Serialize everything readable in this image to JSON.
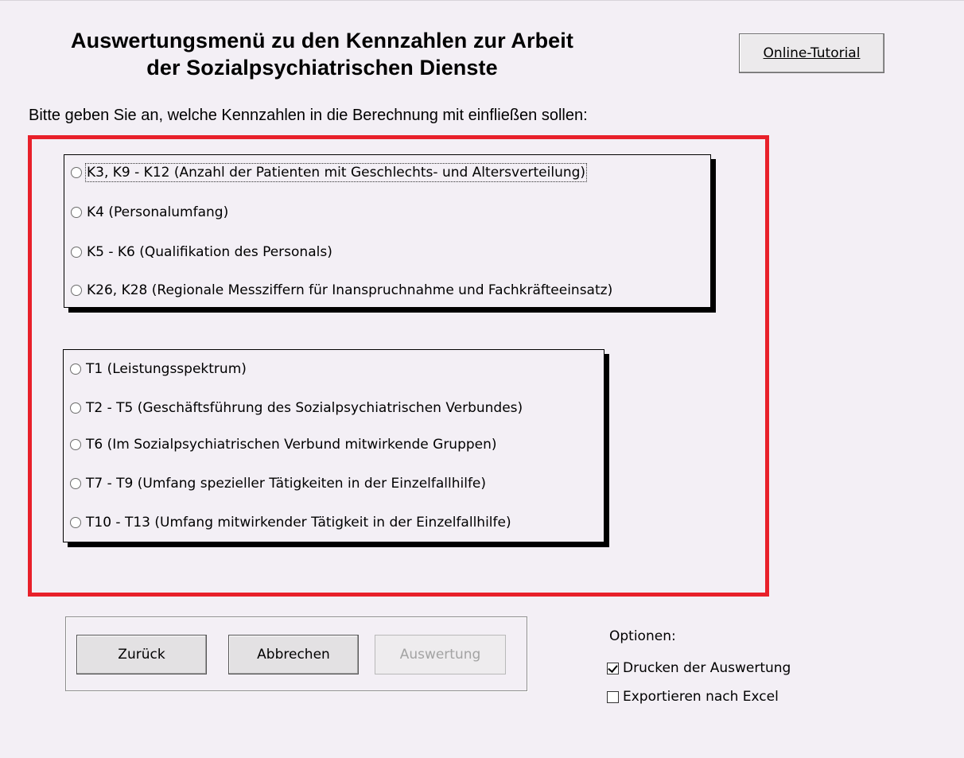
{
  "header": {
    "title_line1": "Auswertungsmenü zu den Kennzahlen zur Arbeit",
    "title_line2": "der Sozialpsychiatrischen Dienste",
    "tutorial_button": "Online-Tutorial"
  },
  "instruction": "Bitte geben Sie an, welche Kennzahlen in die Berechnung mit einfließen sollen:",
  "k_group": {
    "options": [
      {
        "label": "K3, K9 - K12 (Anzahl der Patienten mit Geschlechts- und Altersverteilung)",
        "selected": false,
        "focused": true
      },
      {
        "label": "K4 (Personalumfang)",
        "selected": false
      },
      {
        "label": "K5 - K6 (Qualifikation des Personals)",
        "selected": false
      },
      {
        "label": "K26, K28 (Regionale Messziffern für Inanspruchnahme und Fachkräfteeinsatz)",
        "selected": false
      }
    ]
  },
  "t_group": {
    "options": [
      {
        "label": "T1 (Leistungsspektrum)",
        "selected": false
      },
      {
        "label": "T2 - T5 (Geschäftsführung des Sozialpsychiatrischen Verbundes)",
        "selected": false
      },
      {
        "label": "T6 (Im Sozialpsychiatrischen Verbund mitwirkende Gruppen)",
        "selected": false
      },
      {
        "label": "T7 - T9 (Umfang spezieller Tätigkeiten in der Einzelfallhilfe)",
        "selected": false
      },
      {
        "label": "T10 - T13 (Umfang mitwirkender Tätigkeit in der Einzelfallhilfe)",
        "selected": false
      }
    ]
  },
  "buttons": {
    "back": "Zurück",
    "cancel": "Abbrechen",
    "evaluate": "Auswertung",
    "evaluate_enabled": false
  },
  "options": {
    "heading": "Optionen:",
    "print": {
      "label": "Drucken der Auswertung",
      "checked": true
    },
    "export": {
      "label": "Exportieren nach Excel",
      "checked": false
    }
  },
  "colors": {
    "background": "#f3eff5",
    "highlight_frame": "#e8202a"
  }
}
